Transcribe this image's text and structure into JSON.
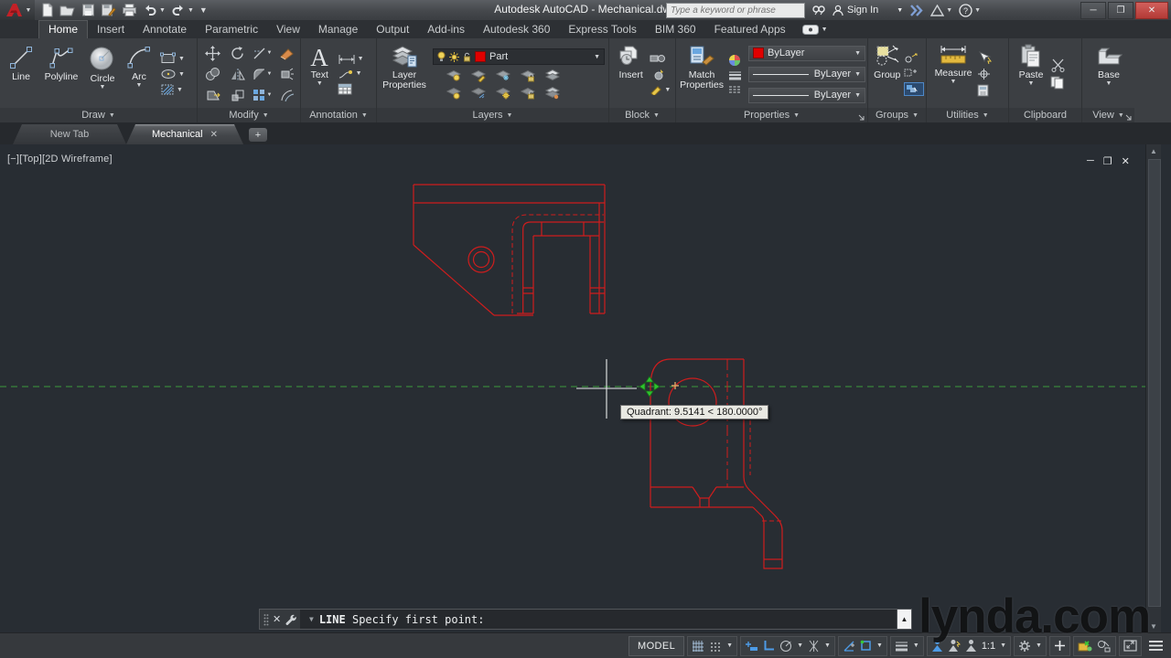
{
  "title_bar": {
    "title": "Autodesk AutoCAD - Mechanical.dwg",
    "search_placeholder": "Type a keyword or phrase",
    "sign_in": "Sign In"
  },
  "ribbon": {
    "tabs": [
      "Home",
      "Insert",
      "Annotate",
      "Parametric",
      "View",
      "Manage",
      "Output",
      "Add-ins",
      "Autodesk 360",
      "Express Tools",
      "BIM 360",
      "Featured Apps"
    ],
    "active_tab": "Home",
    "panels": {
      "draw": {
        "label": "Draw",
        "line": "Line",
        "polyline": "Polyline",
        "circle": "Circle",
        "arc": "Arc"
      },
      "modify": {
        "label": "Modify"
      },
      "annotation": {
        "label": "Annotation",
        "text": "Text"
      },
      "layers": {
        "label": "Layers",
        "layer_properties": "Layer\nProperties",
        "current_layer": "Part"
      },
      "block": {
        "label": "Block",
        "insert": "Insert"
      },
      "properties": {
        "label": "Properties",
        "match": "Match\nProperties",
        "color": "ByLayer",
        "lineweight": "ByLayer",
        "linetype": "ByLayer"
      },
      "groups": {
        "label": "Groups",
        "group": "Group"
      },
      "utilities": {
        "label": "Utilities",
        "measure": "Measure"
      },
      "clipboard": {
        "label": "Clipboard",
        "paste": "Paste"
      },
      "view": {
        "label": "View",
        "base": "Base"
      }
    }
  },
  "file_tabs": {
    "tabs": [
      "New Tab",
      "Mechanical"
    ],
    "active": "Mechanical"
  },
  "viewport": {
    "label": "[−][Top][2D Wireframe]"
  },
  "canvas": {
    "tooltip": "Quadrant: 9.5141 < 180.0000°"
  },
  "command_line": {
    "command": "LINE",
    "prompt": "Specify first point:"
  },
  "status_bar": {
    "model": "MODEL",
    "scale": "1:1"
  },
  "watermark": "lynda.com",
  "colors": {
    "canvas_background": "#282d33",
    "cad_line_red": "#cf1d1d",
    "tracking_green": "#3c9b3c",
    "layer_color_red": "#e00000",
    "status_active_blue": "#4d9be6"
  }
}
